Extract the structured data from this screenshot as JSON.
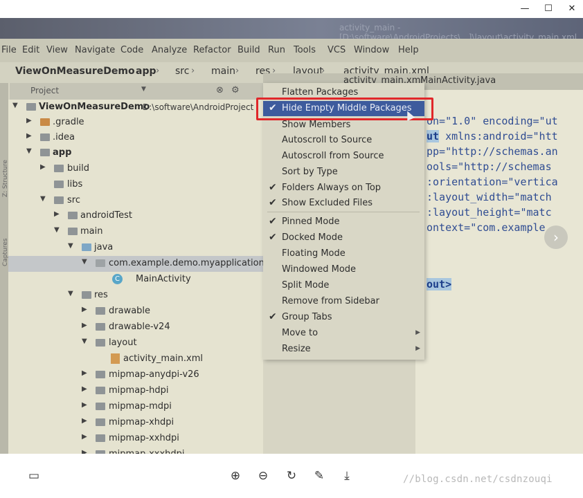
{
  "window_controls": {
    "minimize": "—",
    "maximize": "☐",
    "close": "✕"
  },
  "ide": {
    "title_ghost": "activity_main - [D:\\software\\AndroidProjects\\...]\\layout\\activity_main.xml",
    "menu": [
      "File",
      "Edit",
      "View",
      "Navigate",
      "Code",
      "Analyze",
      "Refactor",
      "Build",
      "Run",
      "Tools",
      "VCS",
      "Window",
      "Help"
    ],
    "breadcrumbs": [
      "ViewOnMeasureDemo",
      "app",
      "src",
      "main",
      "res",
      "layout",
      "activity_main.xml"
    ],
    "project_header": "Project",
    "side_tabs": [
      "Z: Structure",
      "Captures"
    ],
    "tree": [
      {
        "label": "ViewOnMeasureDemo",
        "sub": "D:\\software\\AndroidProject"
      },
      {
        "label": ".gradle"
      },
      {
        "label": ".idea"
      },
      {
        "label": "app"
      },
      {
        "label": "build"
      },
      {
        "label": "libs"
      },
      {
        "label": "src"
      },
      {
        "label": "androidTest"
      },
      {
        "label": "main"
      },
      {
        "label": "java"
      },
      {
        "label": "com.example.demo.myapplication"
      },
      {
        "label": "MainActivity"
      },
      {
        "label": "res"
      },
      {
        "label": "drawable"
      },
      {
        "label": "drawable-v24"
      },
      {
        "label": "layout"
      },
      {
        "label": "activity_main.xml"
      },
      {
        "label": "mipmap-anydpi-v26"
      },
      {
        "label": "mipmap-hdpi"
      },
      {
        "label": "mipmap-mdpi"
      },
      {
        "label": "mipmap-xhdpi"
      },
      {
        "label": "mipmap-xxhdpi"
      },
      {
        "label": "mipmap-xxxhdpi"
      }
    ],
    "tabs": [
      "activity_main.xml",
      "MainActivity.java"
    ],
    "code_lines": [
      {
        "a": "on=\"1.0\" ",
        "b": "encoding=\"ut"
      },
      {
        "hl": "ut",
        "a": " xmlns:android=\"htt"
      },
      {
        "a": "pp=\"http://schemas.an"
      },
      {
        "a": "ools=\"http://schemas"
      },
      {
        "a": ":orientation=\"vertica"
      },
      {
        "a": ":layout_width=\"match"
      },
      {
        "a": ":layout_height=\"matc"
      },
      {
        "a": "ontext=\"com.example."
      },
      {
        "hl": "out>"
      }
    ],
    "popup_menu": [
      {
        "label": "Flatten Packages",
        "checked": false
      },
      {
        "label": "Hide Empty Middle Packages",
        "checked": true,
        "active": true
      },
      {
        "label": "Show Members",
        "checked": false
      },
      {
        "label": "Autoscroll to Source",
        "checked": false
      },
      {
        "label": "Autoscroll from Source",
        "checked": false
      },
      {
        "label": "Sort by Type",
        "checked": false
      },
      {
        "label": "Folders Always on Top",
        "checked": true
      },
      {
        "label": "Show Excluded Files",
        "checked": true
      },
      {
        "label": "Pinned Mode",
        "checked": true
      },
      {
        "label": "Docked Mode",
        "checked": true
      },
      {
        "label": "Floating Mode",
        "checked": false
      },
      {
        "label": "Windowed Mode",
        "checked": false
      },
      {
        "label": "Split Mode",
        "checked": false
      },
      {
        "label": "Remove from Sidebar",
        "checked": false
      },
      {
        "label": "Group Tabs",
        "checked": true
      },
      {
        "label": "Move to",
        "checked": false,
        "submenu": true
      },
      {
        "label": "Resize",
        "checked": false,
        "submenu": true
      }
    ]
  },
  "viewer_tools": {
    "zoom_in": "⊕",
    "zoom_out": "⊖",
    "rotate": "↻",
    "edit": "✎",
    "save": "⤓",
    "thumbnails": "▭"
  },
  "watermark": "//blog.csdn.net/csdnzouqi"
}
